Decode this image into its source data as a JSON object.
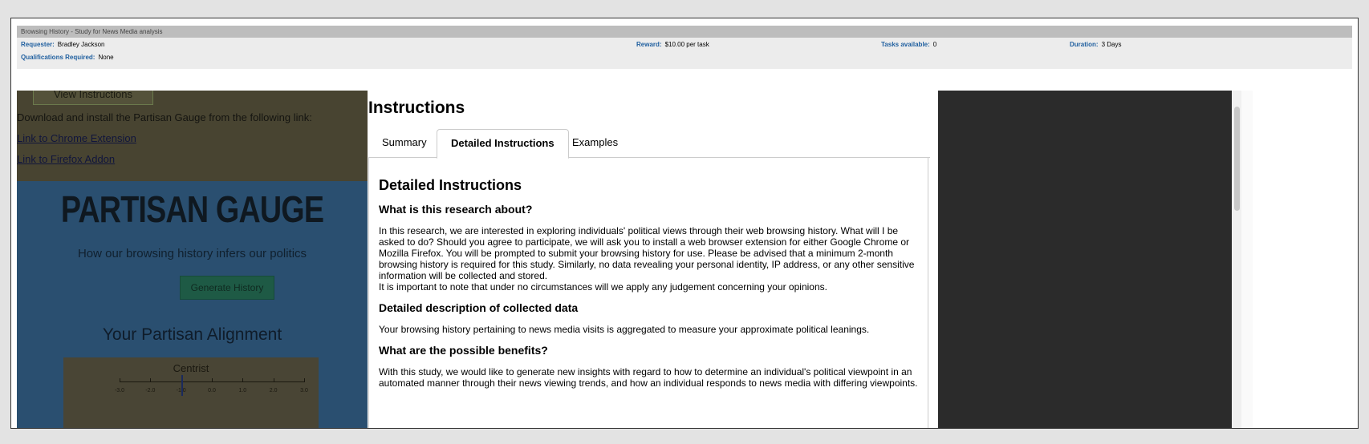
{
  "hit": {
    "title": "Browsing History - Study for News Media analysis",
    "requester_label": "Requester:",
    "requester": "Bradley Jackson",
    "reward_label": "Reward:",
    "reward": "$10.00 per task",
    "tasks_label": "Tasks available:",
    "tasks": "0",
    "duration_label": "Duration:",
    "duration": "3 Days",
    "qual_label": "Qualifications Required:",
    "qual": "None"
  },
  "left": {
    "view_instructions": "View Instructions",
    "download_text": "Download and install the Partisan Gauge from the following link:",
    "chrome_link": "Link to Chrome Extension",
    "firefox_link": "Link to Firefox Addon",
    "gauge_title": "PARTISAN GAUGE",
    "gauge_subtitle": "How our browsing history infers our politics",
    "generate_button": "Generate History",
    "alignment_title": "Your Partisan Alignment",
    "meter_label": "Centrist",
    "meter_ticks": [
      "-3.0",
      "-2.0",
      "-1.0",
      "0.0",
      "1.0",
      "2.0",
      "3.0"
    ],
    "meter_value": -1.0
  },
  "instructions": {
    "heading": "Instructions",
    "tabs": [
      "Summary",
      "Detailed Instructions",
      "Examples"
    ],
    "active_tab": "Detailed Instructions",
    "panel_title": "Detailed Instructions",
    "q1": "What is this research about?",
    "p1": "In this research, we are interested in exploring individuals' political views through their web browsing history. What will I be asked to do? Should you agree to participate, we will ask you to install a web browser extension for either Google Chrome or Mozilla Firefox. You will be prompted to submit your browsing history for use. Please be advised that a minimum 2-month browsing history is required for this study. Similarly, no data revealing your personal identity, IP address, or any other sensitive information will be collected and stored.",
    "p1b": "It is important to note that under no circumstances will we apply any judgement concerning your opinions.",
    "q2": "Detailed description of collected data",
    "p2": "Your browsing history pertaining to news media visits is aggregated to measure your approximate political leanings.",
    "q3": "What are the possible benefits?",
    "p3": "With this study, we would like to generate new insights with regard to how to determine an individual's political viewpoint in an automated manner through their news viewing trends, and how an individual responds to news media with differing viewpoints."
  }
}
